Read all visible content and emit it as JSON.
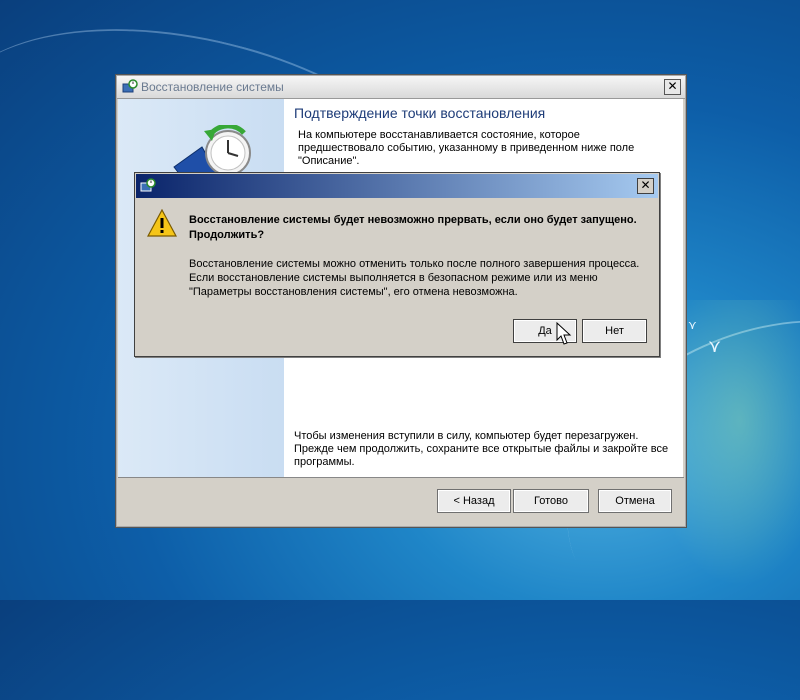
{
  "wizard": {
    "title": "Восстановление системы",
    "heading": "Подтверждение точки восстановления",
    "description": "На компьютере восстанавливается состояние, которое предшествовало событию, указанному в приведенном ниже поле \"Описание\".",
    "reboot_note": "Чтобы изменения вступили в силу, компьютер будет перезагружен. Прежде чем продолжить, сохраните все открытые файлы и закройте все программы.",
    "back_label": "< Назад",
    "finish_label": "Готово",
    "cancel_label": "Отмена",
    "close_label": "✕"
  },
  "dialog": {
    "main_text": "Восстановление системы будет невозможно прервать, если оно будет запущено. Продолжить?",
    "detail_text": "Восстановление системы можно отменить только после полного завершения процесса. Если восстановление системы выполняется в безопасном режиме или из меню \"Параметры восстановления системы\", его отмена невозможна.",
    "yes_label": "Да",
    "no_label": "Нет",
    "close_label": "✕"
  },
  "icons": {
    "window": "system-restore-icon",
    "side": "clock-restore-icon",
    "warning": "warning-icon",
    "cursor": "mouse-cursor-icon"
  },
  "colors": {
    "dialog_title_start": "#0a246a",
    "dialog_title_end": "#a6caf0",
    "heading": "#1e3c78",
    "desktop": "#0d5ea8"
  }
}
